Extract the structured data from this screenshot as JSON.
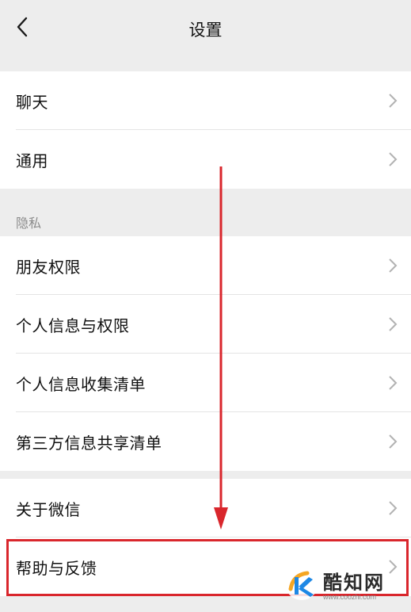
{
  "nav": {
    "title": "设置"
  },
  "groups": [
    {
      "items": [
        {
          "label": "聊天"
        },
        {
          "label": "通用"
        }
      ]
    },
    {
      "header": "隐私",
      "items": [
        {
          "label": "朋友权限"
        },
        {
          "label": "个人信息与权限"
        },
        {
          "label": "个人信息收集清单"
        },
        {
          "label": "第三方信息共享清单"
        }
      ]
    },
    {
      "items": [
        {
          "label": "关于微信"
        },
        {
          "label": "帮助与反馈"
        }
      ]
    }
  ],
  "watermark": {
    "name": "酷知网",
    "url": "www.coozhi.com"
  },
  "colors": {
    "annotation": "#d9262c",
    "background": "#ededed",
    "chevron": "#b2b2b2",
    "logo_blue": "#1e88e5",
    "logo_orange": "#f5a623"
  }
}
